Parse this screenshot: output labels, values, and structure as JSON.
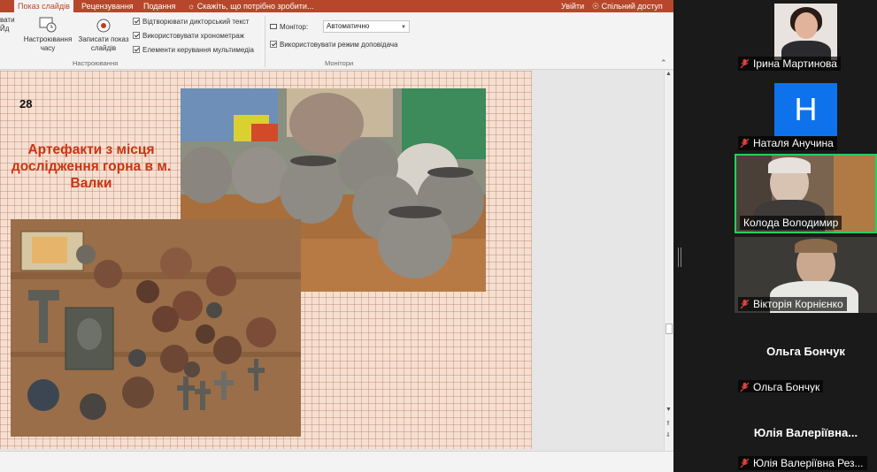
{
  "ribbon_tabs": {
    "slideshow": "Показ слайдів",
    "review": "Рецензування",
    "view": "Подання",
    "tell_me": "Скажіть, що потрібно зробити...",
    "signin": "Увійти",
    "share": "Спільний доступ"
  },
  "ribbon": {
    "record_partial": "вати\nЙд",
    "rehearse_timings": "Настроювання\nчасу",
    "record_slideshow": "Записати показ\nслайдів",
    "play_narrations": "Відтворювати дикторський текст",
    "use_timings": "Використовувати хронометраж",
    "show_media_controls": "Елементи керування мультимедіа",
    "setup_group": "Настроювання",
    "monitor_label": "Монітор:",
    "monitor_value": "Автоматично",
    "presenter_view": "Використовувати режим доповідача",
    "monitors_group": "Монітори"
  },
  "slide": {
    "number": "28",
    "title": "Артефакти з місця дослідження горна в м. Валки"
  },
  "participants": [
    {
      "name": "Ірина Мартинова",
      "muted": true,
      "video": "photo"
    },
    {
      "name": "Наталя Анучина",
      "muted": true,
      "video": "avatar",
      "initial": "Н"
    },
    {
      "name": "Колода Володимир",
      "muted": false,
      "video": "camera",
      "active": true
    },
    {
      "name": "Вікторія Корнієнко",
      "muted": true,
      "video": "camera"
    },
    {
      "name": "Ольга Бончук",
      "muted": true,
      "video": "none",
      "display_name": "Ольга Бончук"
    },
    {
      "name": "Юлія Валеріївна Рез...",
      "muted": true,
      "video": "none",
      "display_name": "Юлія Валеріївна..."
    }
  ],
  "colors": {
    "accent": "#b7472a",
    "slide_title": "#cc3311",
    "active_speaker": "#23d160",
    "avatar_blue": "#0e72ed"
  }
}
